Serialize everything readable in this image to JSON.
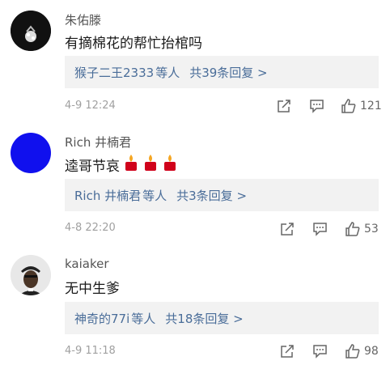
{
  "comments": [
    {
      "username": "朱佑滕",
      "text": "有摘棉花的帮忙抬棺吗",
      "reply_who": "猴子二王2333",
      "reply_suffix": "等人",
      "reply_count": "共39条回复 >",
      "timestamp": "4-9 12:24",
      "likes": "121",
      "avatar_color": "#111111"
    },
    {
      "username": "Rich 井楠君",
      "text": "逵哥节哀",
      "emoji": [
        "candle-emoji",
        "candle-emoji",
        "candle-emoji"
      ],
      "reply_who": "Rich 井楠君",
      "reply_suffix": "等人",
      "reply_count": "共3条回复 >",
      "timestamp": "4-8 22:20",
      "likes": "53",
      "avatar_color": "#1010ee"
    },
    {
      "username": "kaiaker",
      "text": "无中生爹",
      "reply_who": "神奇的77i",
      "reply_suffix": "等人",
      "reply_count": "共18条回复 >",
      "timestamp": "4-9 11:18",
      "likes": "98",
      "avatar_color": "#e8e8e8"
    }
  ],
  "icons": {
    "share": "share-icon",
    "comment": "comment-icon",
    "like": "thumbs-up-icon"
  },
  "colors": {
    "reply_link": "#4a6d99",
    "reply_bg": "#f2f2f2",
    "meta": "#a0a0a0"
  }
}
